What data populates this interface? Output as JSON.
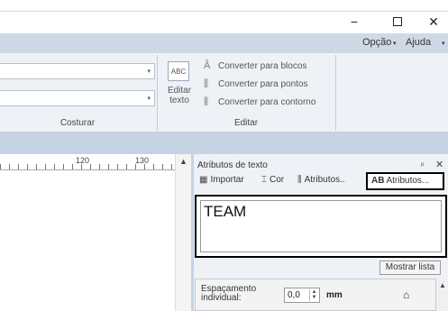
{
  "window": {
    "minimize_glyph": "−",
    "close_glyph": "✕"
  },
  "menu": {
    "option_label": "Opção",
    "help_label": "Ajuda"
  },
  "ribbon": {
    "sew_group_label": "Costurar",
    "edit_group_label": "Editar",
    "abc_label": "ABC",
    "edit_text_label": "Editar texto",
    "convert_blocks": "Converter para blocos",
    "convert_points": "Converter para pontos",
    "convert_contour": "Converter para contorno"
  },
  "ruler": {
    "mark_120": "120",
    "mark_130": "130"
  },
  "panel": {
    "title": "Atributos de texto",
    "pin_glyph": "ᵖ",
    "tools": {
      "import": "Importar",
      "color": "Cor",
      "attributes1": "Atributos..",
      "attributes2": "Atributos...",
      "attributes2_prefix": "AB"
    },
    "text_value": "TEAM",
    "show_list": "Mostrar lista",
    "spacing_label_line1": "Espaçamento",
    "spacing_label_line2": "individual:",
    "spacing_value": "0,0",
    "spacing_unit": "mm"
  },
  "icons": [
    "minimize-icon",
    "maximize-icon",
    "close-icon",
    "dropdown-caret-icon",
    "abc-text-icon",
    "convert-blocks-icon",
    "convert-points-icon",
    "convert-contour-icon",
    "import-icon",
    "color-spool-icon",
    "attributes-icon",
    "pin-icon",
    "home-icon",
    "scroll-up-icon"
  ]
}
